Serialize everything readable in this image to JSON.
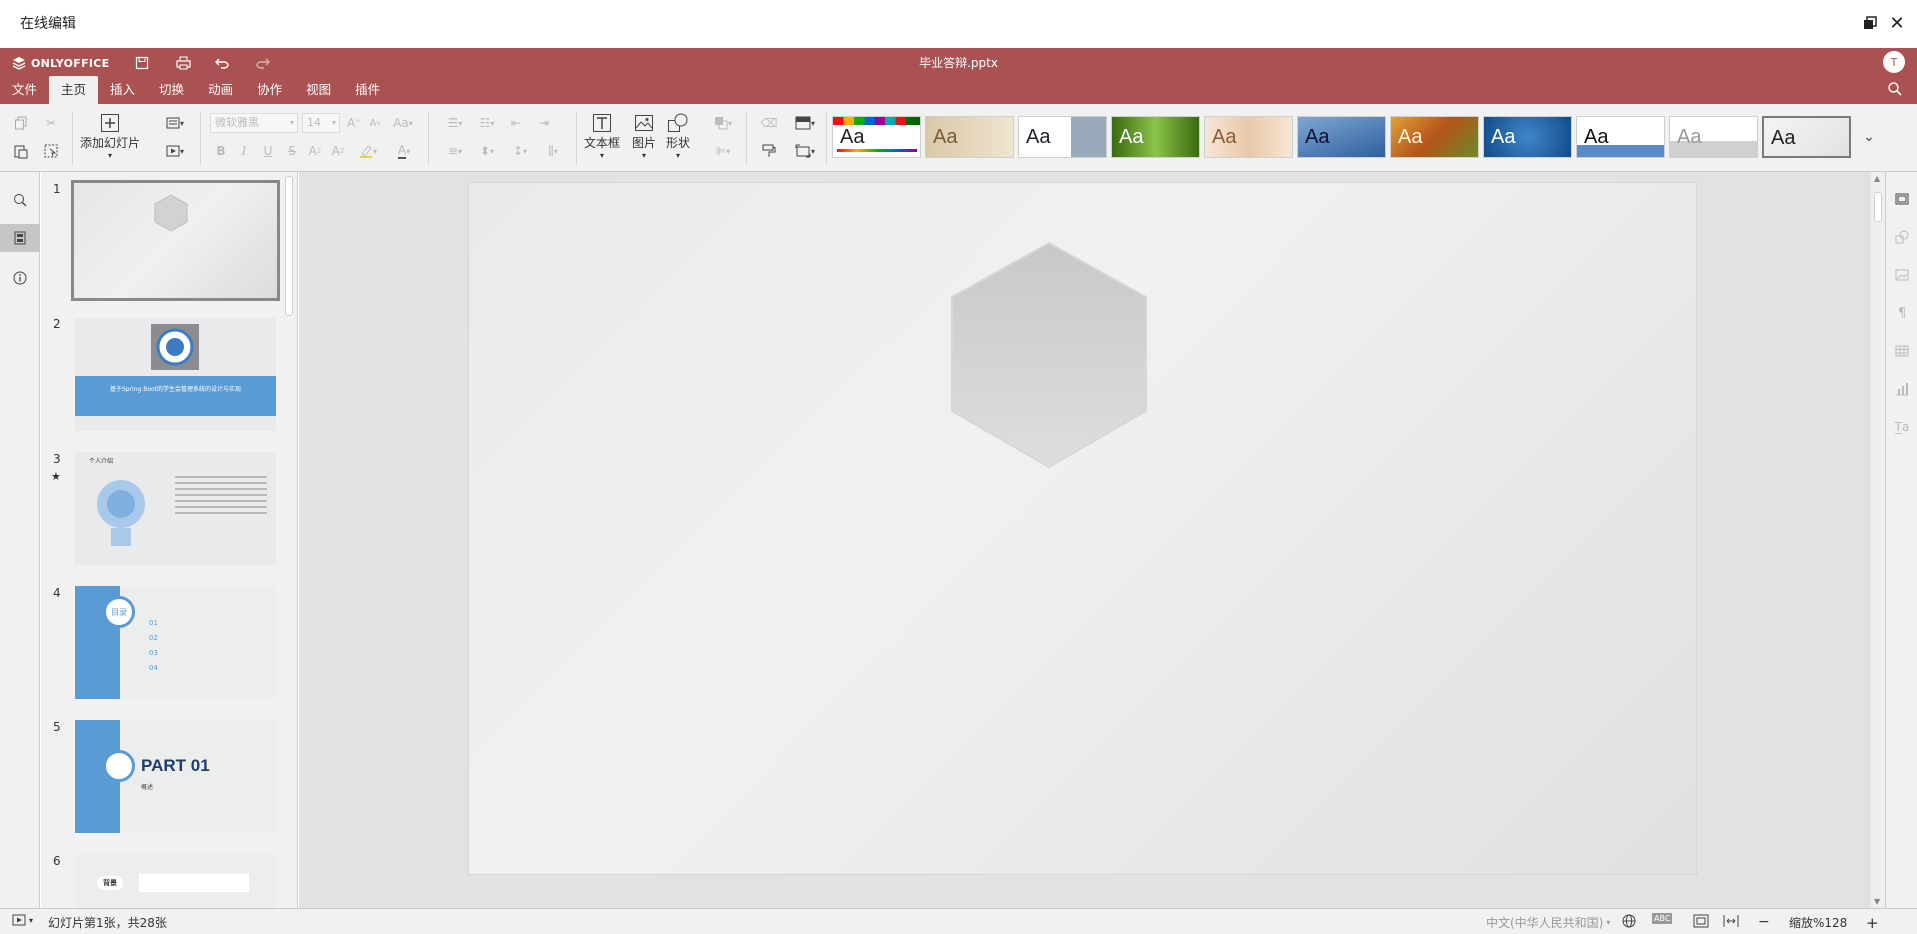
{
  "window": {
    "title": "在线编辑"
  },
  "header": {
    "brand": "ONLYOFFICE",
    "doc_title": "毕业答辩.pptx",
    "user_initial": "T",
    "tabs": [
      {
        "label": "文件"
      },
      {
        "label": "主页"
      },
      {
        "label": "插入"
      },
      {
        "label": "切换"
      },
      {
        "label": "动画"
      },
      {
        "label": "协作"
      },
      {
        "label": "视图"
      },
      {
        "label": "插件"
      }
    ],
    "active_tab": "主页"
  },
  "toolbar": {
    "add_slide": "添加幻灯片",
    "font_name": "微软雅黑",
    "font_size": "14",
    "textbox": "文本框",
    "image": "图片",
    "shape": "形状",
    "theme_label": "Aa"
  },
  "slides_panel": {
    "slides": [
      {
        "num": "1"
      },
      {
        "num": "2",
        "title": "基于Spring Boot的学生会管理系统的设计与实现"
      },
      {
        "num": "3",
        "title": "个人介绍"
      },
      {
        "num": "4",
        "toc_title": "目录",
        "toc_items": [
          "01",
          "02",
          "03",
          "04"
        ]
      },
      {
        "num": "5",
        "part": "PART 01",
        "part_sub": "概述"
      },
      {
        "num": "6",
        "label": "背景"
      }
    ]
  },
  "status": {
    "slide_info": "幻灯片第1张，共28张",
    "language": "中文(中华人民共和国)",
    "zoom": "缩放%128"
  },
  "colors": {
    "header": "#aa5252",
    "accent_blue": "#5b9bd5"
  }
}
